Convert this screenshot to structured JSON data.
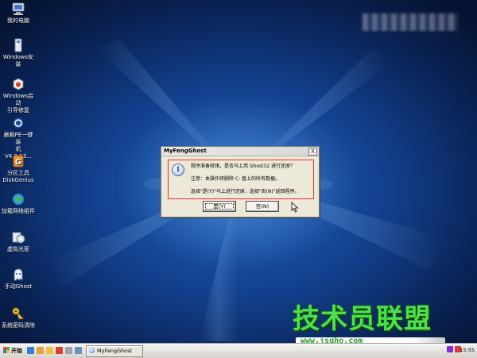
{
  "desktop": {
    "icons": [
      {
        "label": "我的电脑",
        "icon": "computer-icon"
      },
      {
        "label": "Windows安装",
        "icon": "usb-drive-icon"
      },
      {
        "label": "Windows启动\n引导修复",
        "icon": "boot-repair-icon"
      },
      {
        "label": "晨枫PE一键装\n机 V4.0.13...",
        "icon": "install-tool-icon"
      },
      {
        "label": "分区工具\nDiskGenius",
        "icon": "disk-partition-icon"
      },
      {
        "label": "加载网络组件",
        "icon": "network-globe-icon"
      },
      {
        "label": "虚拟光驱",
        "icon": "virtual-cdrom-icon"
      },
      {
        "label": "手动Ghost",
        "icon": "ghost-icon"
      },
      {
        "label": "系统密码清除",
        "icon": "password-key-icon"
      }
    ]
  },
  "dialog": {
    "title": "MyFengGhost",
    "close_label": "X",
    "icon": "info-icon",
    "lines": [
      "程序准备就绪，是否马上用 Ghost32 进行还原？",
      "注意：本操作将删除 C: 盘上的所有数据。",
      "选择\"是(Y)\"马上进行还原，选择\"否(N)\"返回程序。"
    ],
    "yes_label": "是(Y)",
    "no_label": "否(N)",
    "highlight_color": "#e0322d"
  },
  "watermark": {
    "brand": "技术员联盟",
    "url": "www.jsgho.com"
  },
  "taskbar": {
    "start_label": "开始",
    "task_item": "MyFengGhost",
    "time": "15:55"
  },
  "colors": {
    "desktop_blue": "#123f8c",
    "brand_green": "#4ee04a",
    "dialog_bg": "#ece9d8"
  }
}
